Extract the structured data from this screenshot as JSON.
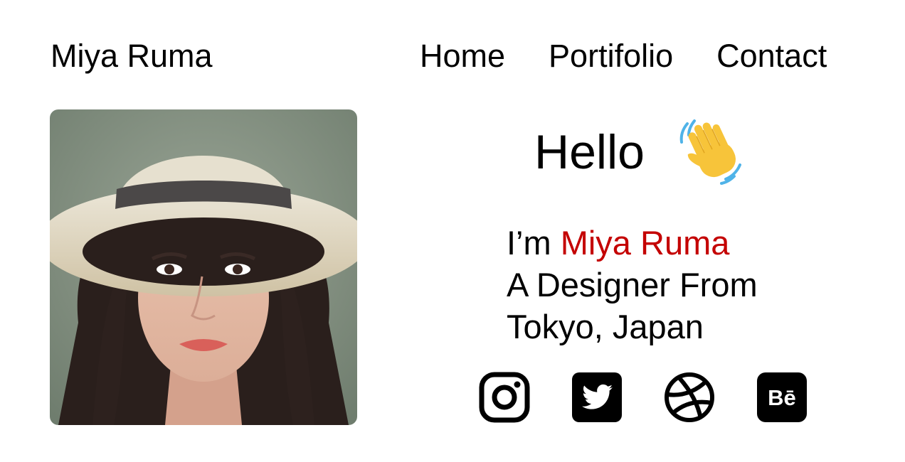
{
  "header": {
    "brand": "Miya Ruma",
    "nav": {
      "home": "Home",
      "portfolio": "Portifolio",
      "contact": "Contact"
    }
  },
  "hero": {
    "greeting": "Hello",
    "wave_icon": "waving-hand-emoji",
    "intro_prefix": "I’m ",
    "name": "Miya Ruma",
    "line2": "A Designer From",
    "line3": "Tokyo, Japan",
    "name_color": "#c40000"
  },
  "photo": {
    "subject": "portrait-photo-woman-in-straw-hat"
  },
  "socials": [
    {
      "icon": "instagram-icon"
    },
    {
      "icon": "twitter-icon"
    },
    {
      "icon": "dribbble-icon"
    },
    {
      "icon": "behance-icon",
      "text": "Bē"
    }
  ]
}
